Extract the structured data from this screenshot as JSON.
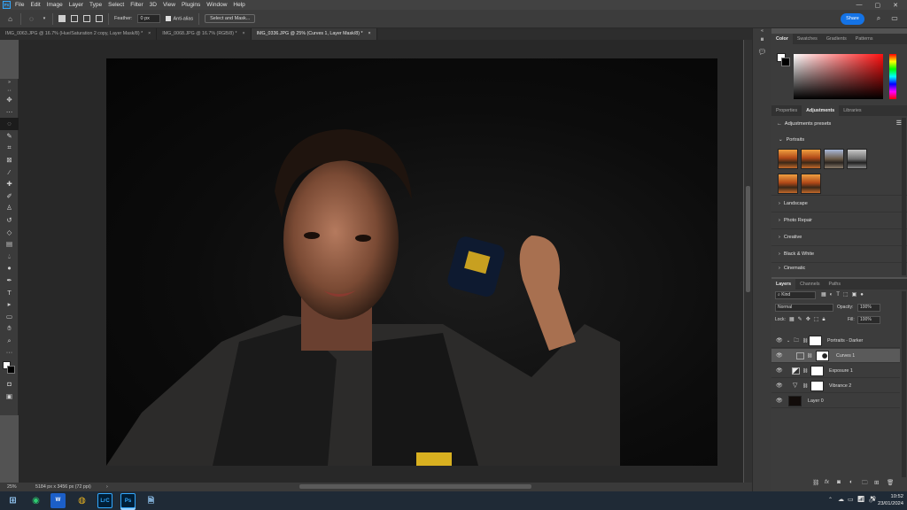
{
  "app": {
    "logo": "Ps"
  },
  "menu": [
    "File",
    "Edit",
    "Image",
    "Layer",
    "Type",
    "Select",
    "Filter",
    "3D",
    "View",
    "Plugins",
    "Window",
    "Help"
  ],
  "window_controls": {
    "minimize": "—",
    "maximize": "▢",
    "close": "✕"
  },
  "options": {
    "feather_label": "Feather:",
    "feather_value": "0 px",
    "antialias_label": "Anti-alias",
    "select_mask_label": "Select and Mask..."
  },
  "share_label": "Share",
  "tabs": [
    {
      "label": "IMG_0063.JPG @ 16.7% (Hue/Saturation 2 copy, Layer Mask/8) *",
      "close": "×"
    },
    {
      "label": "IMG_0068.JPG @ 16.7% (RGB/8) *",
      "close": "×"
    },
    {
      "label": "IMG_0336.JPG @ 25% (Curves 1, Layer Mask/8) *",
      "close": "×"
    }
  ],
  "status": {
    "zoom": "25%",
    "doc_info": "5184 px x 3456 px (72 ppi)",
    "arrow": "›"
  },
  "color_panel": {
    "tabs": [
      "Color",
      "Swatches",
      "Gradients",
      "Patterns"
    ]
  },
  "props_panel": {
    "tabs": [
      "Properties",
      "Adjustments",
      "Libraries"
    ],
    "back": "←",
    "header": "Adjustments presets",
    "sections": [
      "Portraits",
      "Landscape",
      "Photo Repair",
      "Creative",
      "Black & White",
      "Cinematic"
    ],
    "chevron_open": "⌄",
    "chevron_closed": "›"
  },
  "layers_panel": {
    "tabs": [
      "Layers",
      "Channels",
      "Paths"
    ],
    "kind": "Kind",
    "blend_mode": "Normal",
    "opacity_label": "Opacity:",
    "opacity_value": "100%",
    "lock_label": "Lock:",
    "fill_label": "Fill:",
    "fill_value": "100%",
    "layers": [
      {
        "name": "Portraits - Darker"
      },
      {
        "name": "Curves 1"
      },
      {
        "name": "Exposure 1"
      },
      {
        "name": "Vibrance 2"
      },
      {
        "name": "Layer 0"
      }
    ]
  },
  "taskbar": {
    "word": "W",
    "lrc": "LrC",
    "ps": "Ps",
    "time": "10:52",
    "date": "23/01/2024",
    "tray_caret": "⌃"
  },
  "colors": {
    "accent": "#1473e6",
    "ps_blue": "#31a8ff",
    "selected_layer": "#5a5a5a",
    "bg": "#535353"
  }
}
